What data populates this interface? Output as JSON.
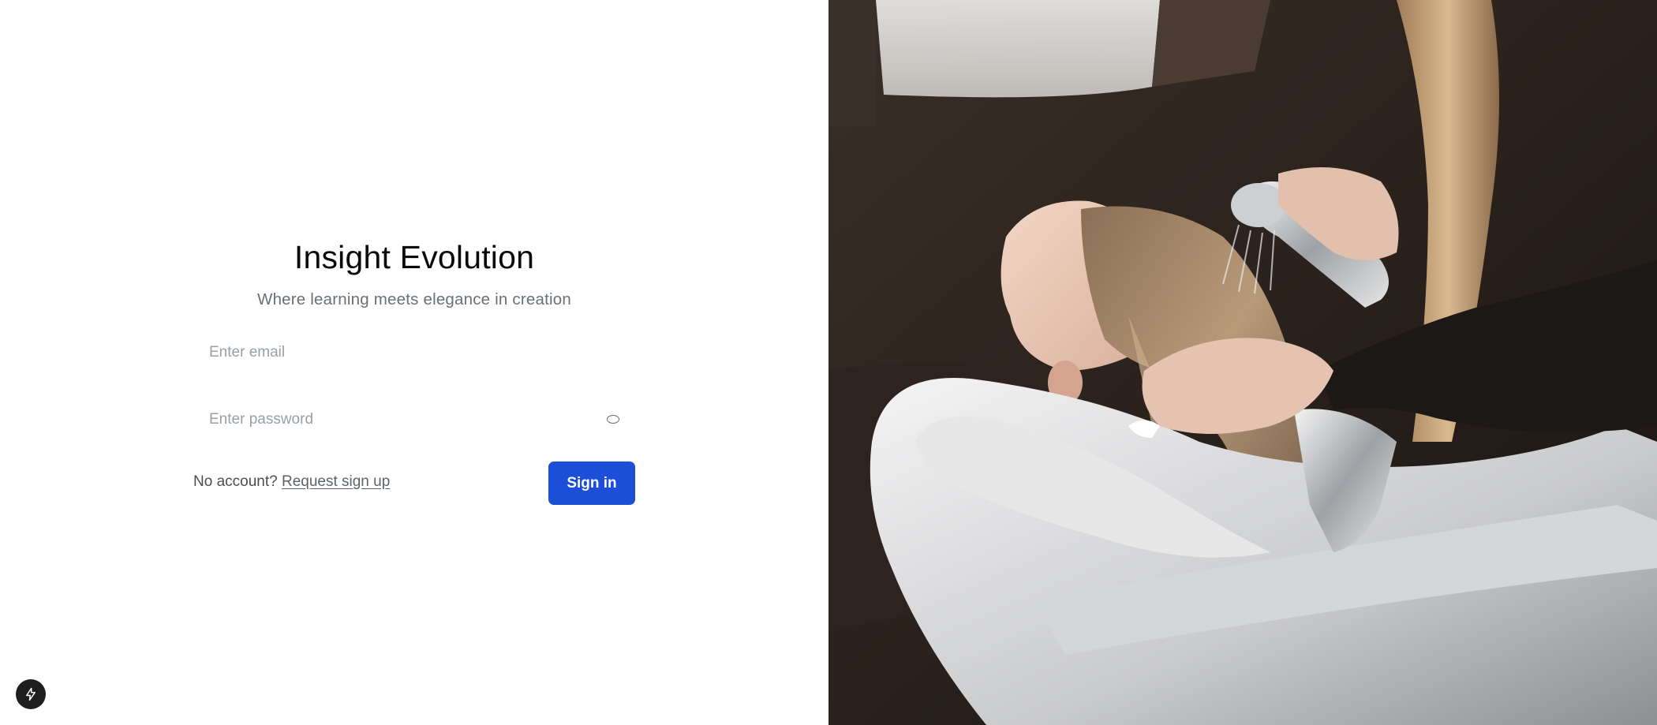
{
  "app": {
    "title": "Insight Evolution",
    "tagline": "Where learning meets elegance in creation"
  },
  "form": {
    "email_placeholder": "Enter email",
    "password_placeholder": "Enter password",
    "no_account_text": "No account?",
    "signup_link": "Request sign up",
    "signin_label": "Sign in"
  },
  "icons": {
    "password_toggle": "eye-icon",
    "dev_badge": "lightning-icon"
  },
  "colors": {
    "primary": "#1d4ed8",
    "title": "#0b0b0b",
    "muted": "#6b6f76"
  }
}
